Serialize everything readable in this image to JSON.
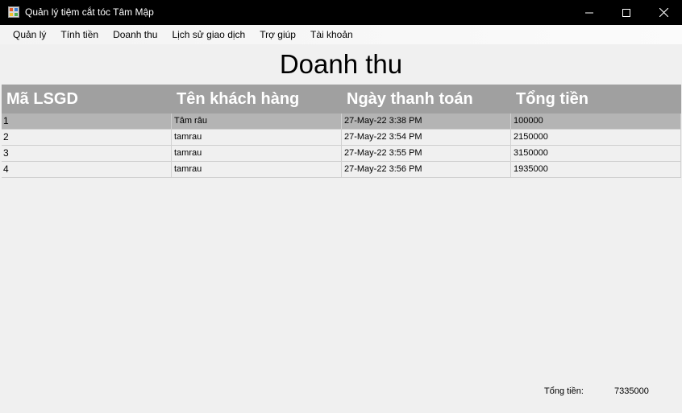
{
  "window": {
    "title": "Quản lý tiệm cắt tóc Tâm Mập",
    "icon": "app-icon",
    "controls": {
      "minimize": "minimize-icon",
      "maximize": "maximize-icon",
      "close": "close-icon"
    }
  },
  "menu": {
    "items": [
      {
        "label": "Quản lý"
      },
      {
        "label": "Tính tiền"
      },
      {
        "label": "Doanh thu"
      },
      {
        "label": "Lịch sử giao dịch"
      },
      {
        "label": "Trợ giúp"
      },
      {
        "label": "Tài khoản"
      }
    ]
  },
  "page": {
    "title": "Doanh thu"
  },
  "grid": {
    "headers": [
      "Mã LSGD",
      "Tên khách hàng",
      "Ngày thanh toán",
      "Tổng tiền"
    ],
    "rows": [
      {
        "id": "1",
        "customer": "Tâm râu",
        "date": "27-May-22 3:38 PM",
        "total": "100000",
        "selected": true
      },
      {
        "id": "2",
        "customer": "tamrau",
        "date": "27-May-22 3:54 PM",
        "total": "2150000",
        "selected": false
      },
      {
        "id": "3",
        "customer": "tamrau",
        "date": "27-May-22 3:55 PM",
        "total": "3150000",
        "selected": false
      },
      {
        "id": "4",
        "customer": "tamrau",
        "date": "27-May-22 3:56 PM",
        "total": "1935000",
        "selected": false
      }
    ]
  },
  "footer": {
    "total_label": "Tổng tiền:",
    "total_value": "7335000"
  },
  "colors": {
    "titlebar": "#000000",
    "header_bg": "#a0a0a0",
    "selected_row": "#b4b4b4",
    "background": "#f0f0f0"
  }
}
